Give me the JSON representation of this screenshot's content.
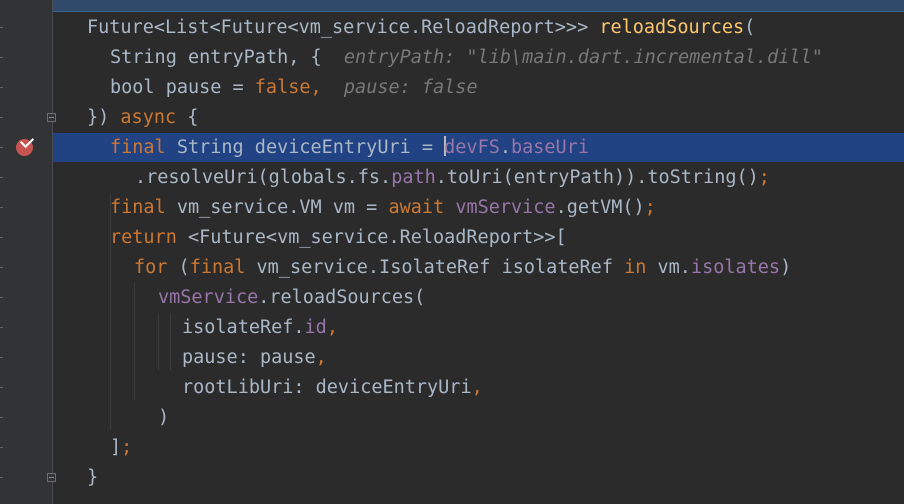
{
  "editor": {
    "language": "Dart",
    "theme": "Darcula",
    "colors": {
      "background": "#2b2b2b",
      "gutter": "#313335",
      "selection": "#214283",
      "keyword": "#cc7832",
      "function": "#ffc66d",
      "field": "#9876aa",
      "text": "#a9b7c6",
      "hint": "#787878",
      "breakpoint": "#c75450"
    },
    "breakpoint_icon": "breakpoint-verified-icon",
    "fold_icon": "fold-marker-icon",
    "lines": [
      {
        "tokens": [
          {
            "t": "Future<List<Future<vm_service.ReloadReport>>> "
          },
          {
            "t": "reloadSources",
            "c": "fn"
          },
          {
            "t": "("
          }
        ]
      },
      {
        "tokens": [
          {
            "t": "String entryPath, {  "
          },
          {
            "t": "entryPath: \"lib\\main.dart.incremental.dill\"",
            "c": "hint"
          }
        ]
      },
      {
        "tokens": [
          {
            "t": "bool pause = "
          },
          {
            "t": "false",
            "c": "kw"
          },
          {
            "t": ",",
            "c": "kw"
          },
          {
            "t": "  "
          },
          {
            "t": "pause: false",
            "c": "hint"
          }
        ]
      },
      {
        "tokens": [
          {
            "t": "}) "
          },
          {
            "t": "async",
            "c": "kw"
          },
          {
            "t": " {"
          }
        ]
      },
      {
        "tokens": [
          {
            "t": "final",
            "c": "kw"
          },
          {
            "t": " String deviceEntryUri = "
          },
          {
            "cursor": true
          },
          {
            "t": "devFS",
            "c": "fld"
          },
          {
            "t": "."
          },
          {
            "t": "baseUri",
            "c": "fld"
          }
        ]
      },
      {
        "tokens": [
          {
            "t": ".resolveUri(globals.fs."
          },
          {
            "t": "path",
            "c": "fld"
          },
          {
            "t": ".toUri(entryPath)).toString()"
          },
          {
            "t": ";",
            "c": "kw"
          }
        ]
      },
      {
        "tokens": [
          {
            "t": "final",
            "c": "kw"
          },
          {
            "t": " vm_service.VM vm = "
          },
          {
            "t": "await",
            "c": "kw"
          },
          {
            "t": " "
          },
          {
            "t": "vmService",
            "c": "fld"
          },
          {
            "t": ".getVM()"
          },
          {
            "t": ";",
            "c": "kw"
          }
        ]
      },
      {
        "tokens": [
          {
            "t": "return",
            "c": "kw"
          },
          {
            "t": " <Future<vm_service.ReloadReport>>["
          }
        ]
      },
      {
        "tokens": [
          {
            "t": "for",
            "c": "kw"
          },
          {
            "t": " ("
          },
          {
            "t": "final",
            "c": "kw"
          },
          {
            "t": " vm_service.IsolateRef isolateRef "
          },
          {
            "t": "in",
            "c": "kw"
          },
          {
            "t": " vm."
          },
          {
            "t": "isolates",
            "c": "fld"
          },
          {
            "t": ")"
          }
        ]
      },
      {
        "tokens": [
          {
            "t": "vmService",
            "c": "fld"
          },
          {
            "t": ".reloadSources("
          }
        ]
      },
      {
        "tokens": [
          {
            "t": "isolateRef."
          },
          {
            "t": "id",
            "c": "fld"
          },
          {
            "t": ",",
            "c": "kw"
          }
        ]
      },
      {
        "tokens": [
          {
            "t": "pause: pause"
          },
          {
            "t": ",",
            "c": "kw"
          }
        ]
      },
      {
        "tokens": [
          {
            "t": "rootLibUri: deviceEntryUri"
          },
          {
            "t": ",",
            "c": "kw"
          }
        ]
      },
      {
        "tokens": [
          {
            "t": ")"
          }
        ]
      },
      {
        "tokens": [
          {
            "t": "]"
          },
          {
            "t": ";",
            "c": "kw"
          }
        ]
      },
      {
        "tokens": [
          {
            "t": "}"
          }
        ]
      }
    ]
  }
}
